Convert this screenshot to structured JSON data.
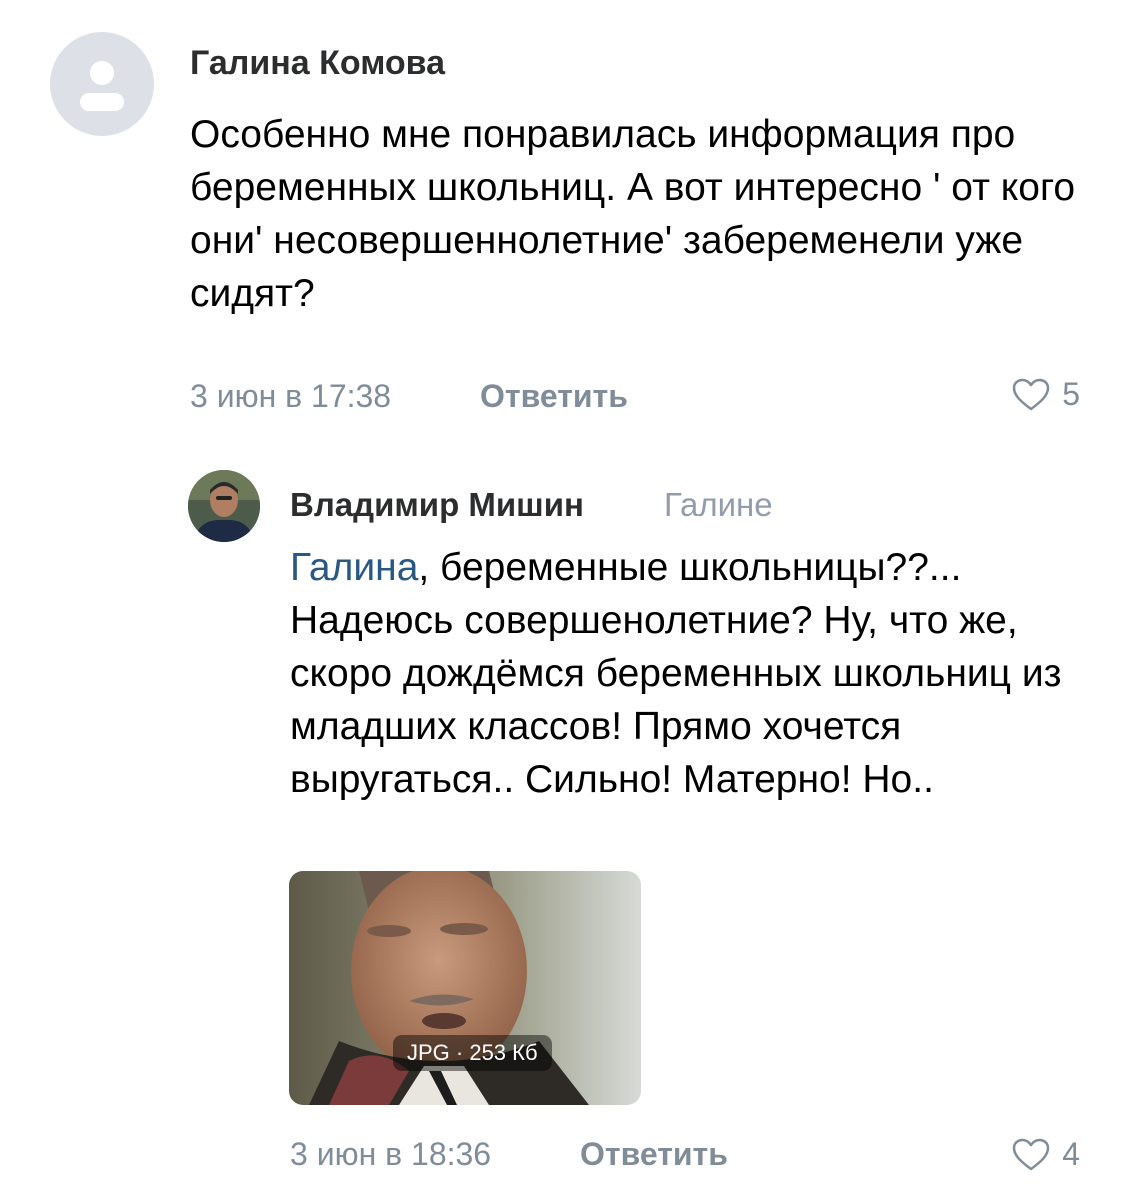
{
  "comments": [
    {
      "author": "Галина Комова",
      "text": "Особенно мне понравилась информация про беременных школьниц. А вот интересно ' от кого они' несовершеннолетние' забеременели уже сидят?",
      "date": "3 июн в 17:38",
      "reply_label": "Ответить",
      "likes": "5",
      "avatar_icon": "default-user-icon"
    },
    {
      "author": "Владимир Мишин",
      "reply_to": "Галине",
      "mention": "Галина",
      "text": ", беременные школьницы??... Надеюсь совершенолетние? Ну, что же, скоро дождёмся беременных школьниц из младших классов! Прямо хочется выругаться.. Сильно! Матерно! Но..",
      "attachment": {
        "type": "image",
        "label": "JPG · 253 Кб"
      },
      "date": "3 июн в 18:36",
      "reply_label": "Ответить",
      "likes": "4"
    }
  ],
  "colors": {
    "secondary_text": "#818c99",
    "link": "#2a5885",
    "author_text": "#2c2d2e",
    "avatar_placeholder": "#dde1e7"
  }
}
